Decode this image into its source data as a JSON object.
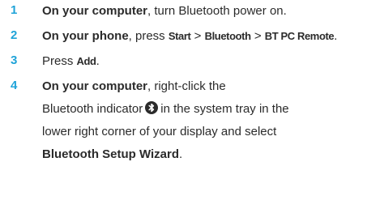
{
  "accent_color": "#1fa3d8",
  "steps": [
    {
      "number": "1",
      "lead_bold": "On your computer",
      "rest": ", turn Bluetooth power on."
    },
    {
      "number": "2",
      "lead_bold": "On your phone",
      "press": ", press ",
      "key_start": "Start",
      "sep1": " > ",
      "key_bluetooth": "Bluetooth",
      "sep2": " > ",
      "key_bt_pc_remote": "BT PC Remote",
      "end": "."
    },
    {
      "number": "3",
      "press": "Press ",
      "key_add": "Add",
      "end": "."
    },
    {
      "number": "4",
      "lead_bold": "On your computer",
      "line1_rest": ", right-click the",
      "line2_before_icon": "Bluetooth indicator",
      "icon": "bluetooth-icon",
      "line2_after_icon": "in the system tray in the",
      "line3": "lower right corner of your display and select",
      "line4_bold": "Bluetooth Setup Wizard",
      "line4_end": "."
    }
  ]
}
